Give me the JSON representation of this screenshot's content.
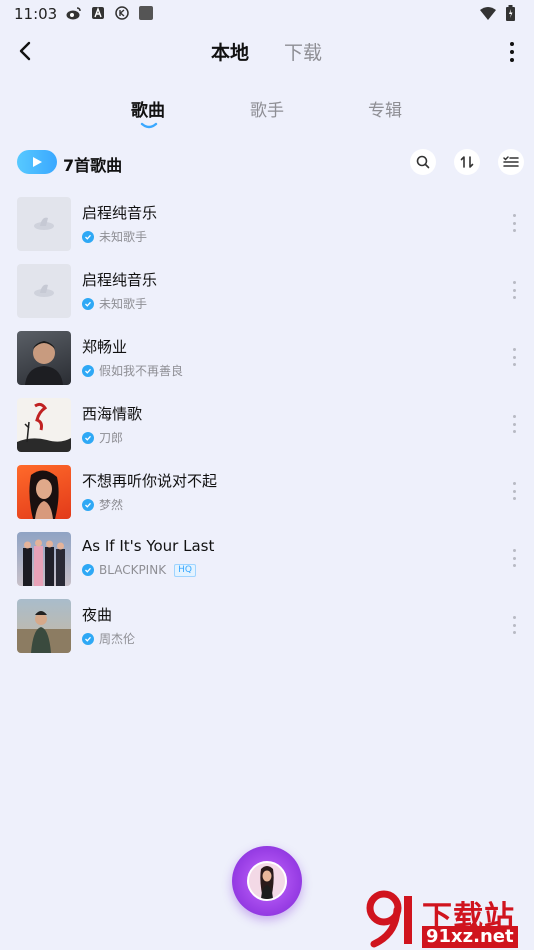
{
  "status_bar": {
    "time": "11:03"
  },
  "header": {
    "tabs": [
      {
        "label": "本地",
        "active": true
      },
      {
        "label": "下载",
        "active": false
      }
    ]
  },
  "sub_tabs": [
    {
      "label": "歌曲",
      "active": true
    },
    {
      "label": "歌手",
      "active": false
    },
    {
      "label": "专辑",
      "active": false
    }
  ],
  "play_bar": {
    "count_label": "7首歌曲"
  },
  "songs": [
    {
      "title": "启程纯音乐",
      "artist": "未知歌手",
      "hq": false,
      "cover": "placeholder"
    },
    {
      "title": "启程纯音乐",
      "artist": "未知歌手",
      "hq": false,
      "cover": "placeholder"
    },
    {
      "title": "郑畅业",
      "artist": "假如我不再善良",
      "hq": false,
      "cover": "portrait-dark"
    },
    {
      "title": "西海情歌",
      "artist": "刀郎",
      "hq": false,
      "cover": "poster-white"
    },
    {
      "title": "不想再听你说对不起",
      "artist": "梦然",
      "hq": false,
      "cover": "portrait-orange"
    },
    {
      "title": "As If It's Your Last",
      "artist": "BLACKPINK",
      "hq": true,
      "hq_label": "HQ",
      "cover": "group-photo"
    },
    {
      "title": "夜曲",
      "artist": "周杰伦",
      "hq": false,
      "cover": "portrait-outdoor"
    }
  ],
  "watermark": {
    "brand": "下载站",
    "url": "91xz.net",
    "logo_digit": "9"
  },
  "colors": {
    "background": "#eef0fb",
    "accent": "#3aa8ff",
    "verified": "#2ea8f5",
    "player": "#9b40e6",
    "watermark": "#d0141e"
  }
}
